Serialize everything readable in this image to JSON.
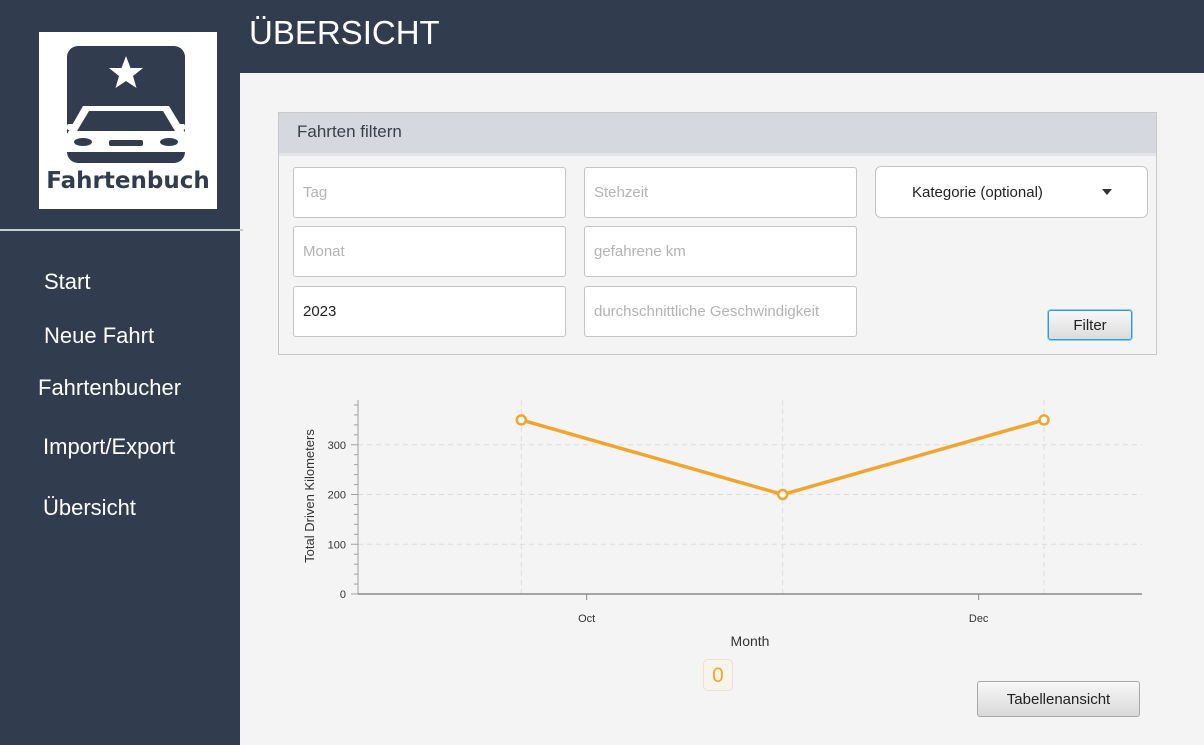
{
  "sidebar": {
    "logo_text": "Fahrtenbuch",
    "items": [
      {
        "label": "Start"
      },
      {
        "label": "Neue Fahrt"
      },
      {
        "label": "Fahrtenbucher"
      },
      {
        "label": "Import/Export"
      },
      {
        "label": "Übersicht"
      }
    ]
  },
  "header": {
    "title": "ÜBERSICHT"
  },
  "filter": {
    "title": "Fahrten filtern",
    "day_placeholder": "Tag",
    "month_placeholder": "Monat",
    "year_value": "2023",
    "stop_time_placeholder": "Stehzeit",
    "km_placeholder": "gefahrene km",
    "avg_speed_placeholder": "durchschnittliche Geschwindigkeit",
    "category_label": "Kategorie (optional)",
    "filter_button": "Filter"
  },
  "chart_data": {
    "type": "line",
    "xlabel": "Month",
    "ylabel": "Total Driven Kilometers",
    "x_tick_labels": [
      "Oct",
      "Dec"
    ],
    "y_ticks": [
      0,
      100,
      200,
      300
    ],
    "ylim": [
      0,
      390
    ],
    "grid": true,
    "series": [
      {
        "points": [
          {
            "x": "2023-09-29",
            "y": 350
          },
          {
            "x": "2023-11-08",
            "y": 200
          },
          {
            "x": "2023-12-18",
            "y": 350
          }
        ]
      }
    ],
    "x_ticks": [
      {
        "label": "Oct",
        "date": "2023-10-09"
      },
      {
        "label": "Dec",
        "date": "2023-12-08"
      }
    ],
    "x_grid_dates": [
      "2023-09-29",
      "2023-11-08",
      "2023-12-18"
    ],
    "xlim": [
      "2023-09-04",
      "2024-01-02"
    ],
    "line_color": "#f2a52e"
  },
  "badge": {
    "value": "0"
  },
  "table_view_button": "Tabellenansicht"
}
